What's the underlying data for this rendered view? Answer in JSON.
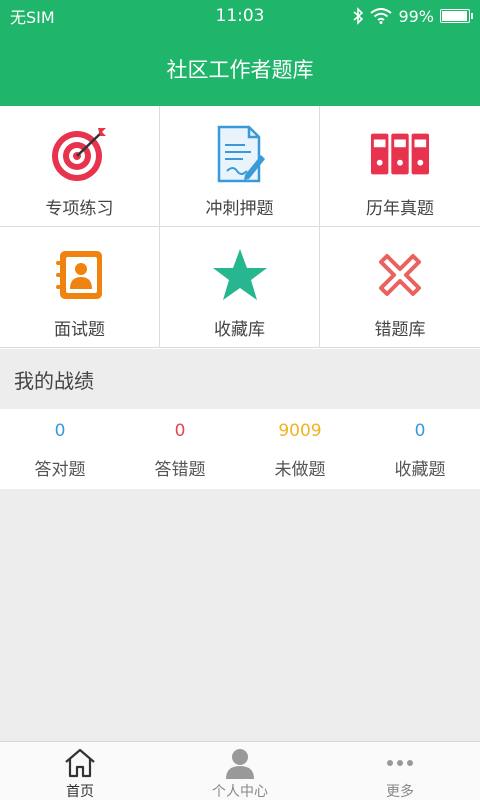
{
  "status_bar": {
    "carrier": "无SIM",
    "time": "11:03",
    "battery_percent": "99%",
    "battery_level": 0.99
  },
  "header": {
    "title": "社区工作者题库"
  },
  "grid_items": [
    {
      "label": "专项练习",
      "icon": "target-icon"
    },
    {
      "label": "冲刺押题",
      "icon": "document-pen-icon"
    },
    {
      "label": "历年真题",
      "icon": "binders-icon"
    },
    {
      "label": "面试题",
      "icon": "contact-book-icon"
    },
    {
      "label": "收藏库",
      "icon": "star-icon"
    },
    {
      "label": "错题库",
      "icon": "cross-icon"
    }
  ],
  "section": {
    "title": "我的战绩"
  },
  "stats": [
    {
      "value": "0",
      "label": "答对题",
      "color": "#3a9ad9"
    },
    {
      "value": "0",
      "label": "答错题",
      "color": "#e8464e"
    },
    {
      "value": "9009",
      "label": "未做题",
      "color": "#f0b323"
    },
    {
      "value": "0",
      "label": "收藏题",
      "color": "#3a9ad9"
    }
  ],
  "tabbar": {
    "items": [
      {
        "label": "首页",
        "icon": "home-icon",
        "active": true
      },
      {
        "label": "个人中心",
        "icon": "user-icon",
        "active": false
      },
      {
        "label": "更多",
        "icon": "more-icon",
        "active": false
      }
    ]
  },
  "colors": {
    "brand": "#1fb56a",
    "tab_active": "#333333",
    "tab_inactive": "#888888"
  }
}
